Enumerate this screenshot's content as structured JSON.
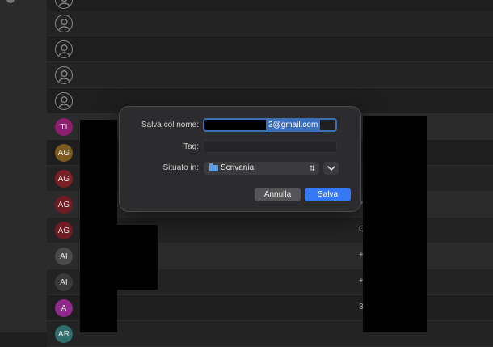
{
  "contacts": [
    {
      "initials": "",
      "color": "",
      "empty": true
    },
    {
      "initials": "",
      "color": "",
      "empty": true
    },
    {
      "initials": "",
      "color": "",
      "empty": true
    },
    {
      "initials": "",
      "color": "",
      "empty": true
    },
    {
      "initials": "",
      "color": "",
      "empty": true
    },
    {
      "initials": "TI",
      "color": "#8c1f6e",
      "empty": false
    },
    {
      "initials": "AG",
      "color": "#7a5a1e",
      "empty": false
    },
    {
      "initials": "AG",
      "color": "#7a1f24",
      "empty": false
    },
    {
      "initials": "AG",
      "color": "#6e1c22",
      "empty": false
    },
    {
      "initials": "AG",
      "color": "#6e1c22",
      "empty": false
    },
    {
      "initials": "AI",
      "color": "#4a4a4a",
      "empty": false
    },
    {
      "initials": "AI",
      "color": "#3a3a3a",
      "empty": false
    },
    {
      "initials": "A",
      "color": "#8e2a8a",
      "empty": false
    },
    {
      "initials": "AR",
      "color": "#2f6e6a",
      "empty": false
    }
  ],
  "row_glyphs": [
    "",
    "",
    "",
    "",
    "",
    "",
    "",
    "",
    "+",
    "C",
    "+",
    "+",
    "3",
    ""
  ],
  "dialog": {
    "save_as_label": "Salva col nome:",
    "filename_visible": "3@gmail.com",
    "tag_label": "Tag:",
    "location_label": "Situato in:",
    "location_value": "Scrivania",
    "cancel_label": "Annulla",
    "save_label": "Salva"
  },
  "colors": {
    "accent": "#3478f6",
    "folder": "#5aa0e8"
  }
}
